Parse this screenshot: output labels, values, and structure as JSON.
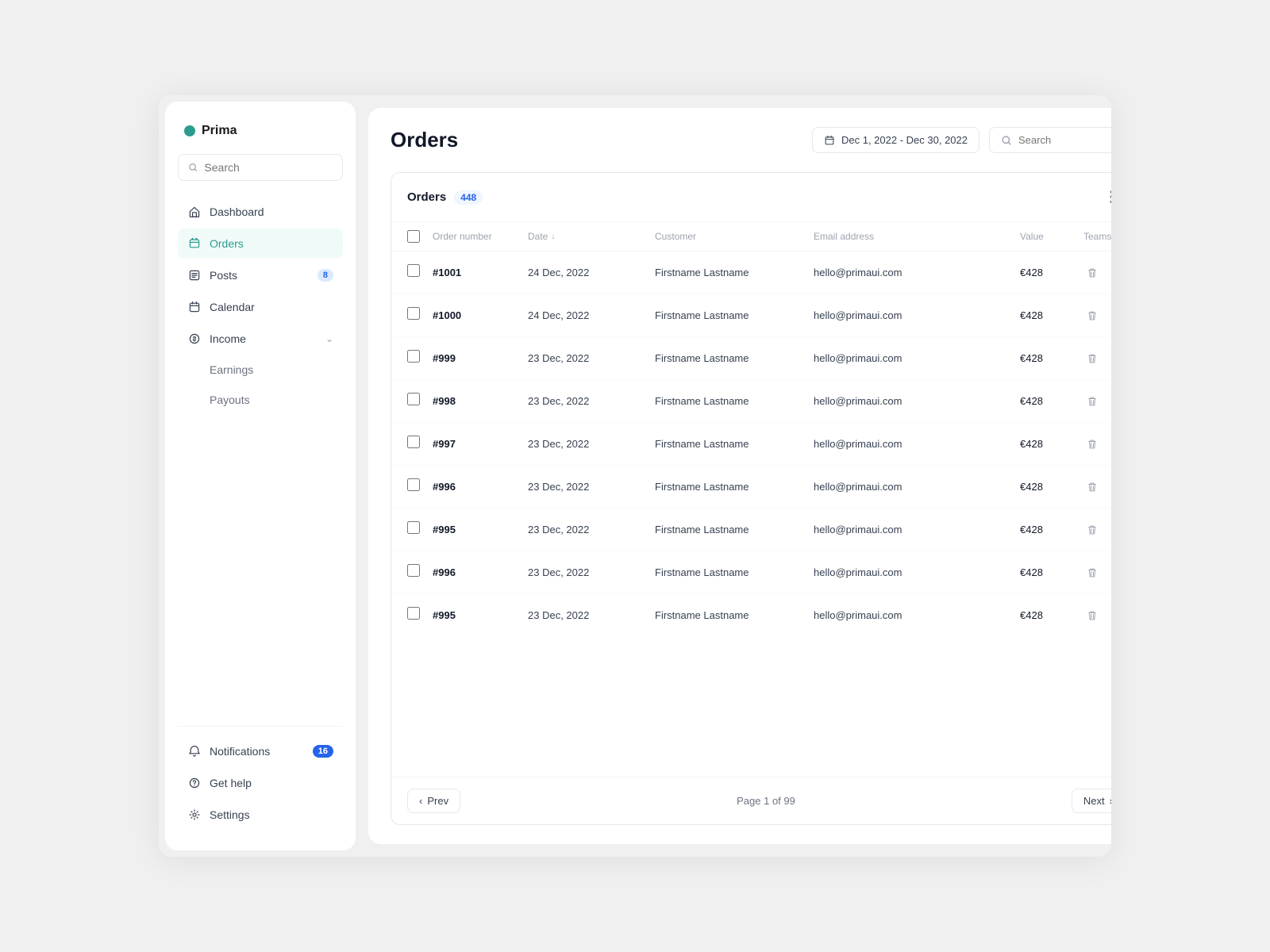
{
  "app": {
    "name": "Prima",
    "logo_color": "#2a9d8f"
  },
  "sidebar": {
    "search_placeholder": "Search",
    "nav_items": [
      {
        "id": "dashboard",
        "label": "Dashboard",
        "icon": "home",
        "active": false,
        "badge": null
      },
      {
        "id": "orders",
        "label": "Orders",
        "icon": "orders",
        "active": true,
        "badge": null
      },
      {
        "id": "posts",
        "label": "Posts",
        "icon": "posts",
        "active": false,
        "badge": "8"
      },
      {
        "id": "calendar",
        "label": "Calendar",
        "icon": "calendar",
        "active": false,
        "badge": null
      },
      {
        "id": "income",
        "label": "Income",
        "icon": "income",
        "active": false,
        "badge": null,
        "hasChevron": true
      }
    ],
    "income_sub": [
      {
        "id": "earnings",
        "label": "Earnings"
      },
      {
        "id": "payouts",
        "label": "Payouts"
      }
    ],
    "bottom_items": [
      {
        "id": "notifications",
        "label": "Notifications",
        "icon": "bell",
        "badge": "16"
      },
      {
        "id": "get-help",
        "label": "Get help",
        "icon": "help"
      },
      {
        "id": "settings",
        "label": "Settings",
        "icon": "settings"
      }
    ]
  },
  "header": {
    "page_title": "Orders",
    "date_range": "Dec 1, 2022 - Dec 30, 2022",
    "search_placeholder": "Search"
  },
  "table": {
    "title": "Orders",
    "count": "448",
    "columns": [
      "Order number",
      "Date",
      "Customer",
      "Email address",
      "Value",
      "Teams"
    ],
    "rows": [
      {
        "order": "#1001",
        "date": "24 Dec, 2022",
        "customer": "Firstname Lastname",
        "email": "hello@primaui.com",
        "value": "€428"
      },
      {
        "order": "#1000",
        "date": "24 Dec, 2022",
        "customer": "Firstname Lastname",
        "email": "hello@primaui.com",
        "value": "€428"
      },
      {
        "order": "#999",
        "date": "23 Dec, 2022",
        "customer": "Firstname Lastname",
        "email": "hello@primaui.com",
        "value": "€428"
      },
      {
        "order": "#998",
        "date": "23 Dec, 2022",
        "customer": "Firstname Lastname",
        "email": "hello@primaui.com",
        "value": "€428"
      },
      {
        "order": "#997",
        "date": "23 Dec, 2022",
        "customer": "Firstname Lastname",
        "email": "hello@primaui.com",
        "value": "€428"
      },
      {
        "order": "#996",
        "date": "23 Dec, 2022",
        "customer": "Firstname Lastname",
        "email": "hello@primaui.com",
        "value": "€428"
      },
      {
        "order": "#995",
        "date": "23 Dec, 2022",
        "customer": "Firstname Lastname",
        "email": "hello@primaui.com",
        "value": "€428"
      },
      {
        "order": "#996",
        "date": "23 Dec, 2022",
        "customer": "Firstname Lastname",
        "email": "hello@primaui.com",
        "value": "€428"
      },
      {
        "order": "#995",
        "date": "23 Dec, 2022",
        "customer": "Firstname Lastname",
        "email": "hello@primaui.com",
        "value": "€428"
      }
    ],
    "pagination": {
      "prev_label": "Prev",
      "next_label": "Next",
      "page_info": "Page 1 of 99"
    }
  }
}
